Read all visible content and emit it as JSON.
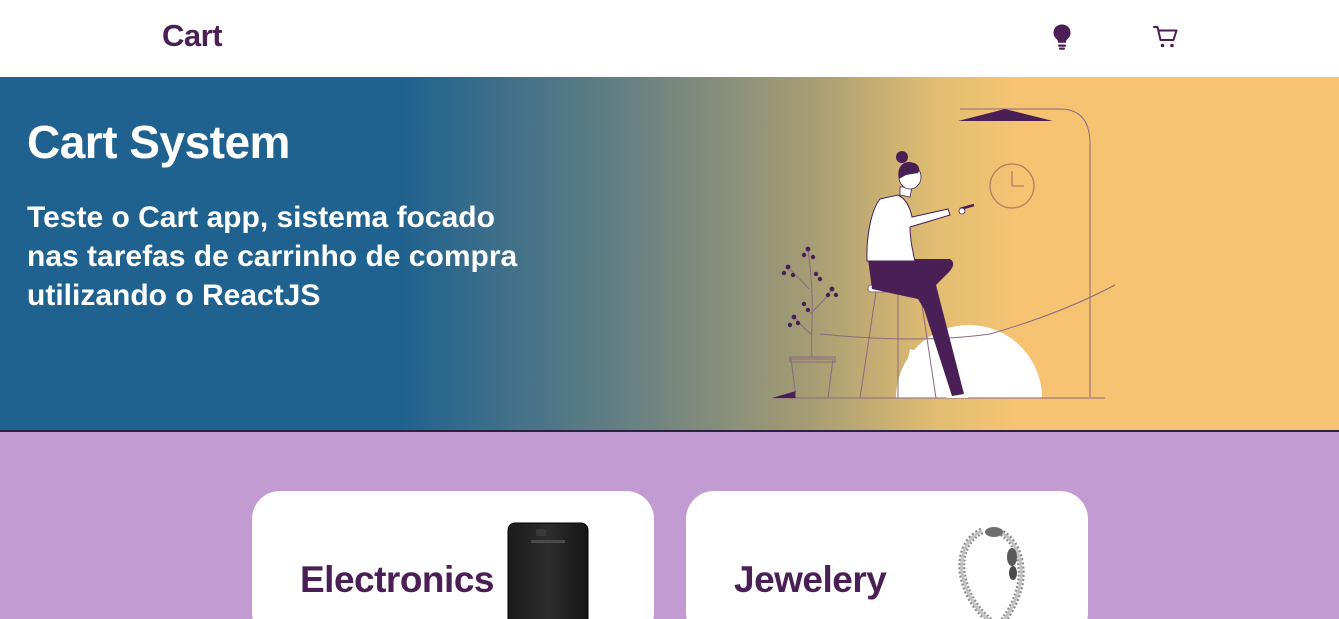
{
  "navbar": {
    "brand": "Cart",
    "icons": [
      "lightbulb-icon",
      "cart-icon"
    ]
  },
  "hero": {
    "title": "Cart System",
    "subtitle": "Teste o Cart app, sistema focado nas tarefas de carrinho de compra utilizando o ReactJS"
  },
  "categories": [
    {
      "label": "Electronics",
      "image": "external-hard-drive"
    },
    {
      "label": "Jewelery",
      "image": "silver-bracelet"
    }
  ],
  "colors": {
    "brand_purple": "#4a1f55",
    "background_lilac": "#c39bd3",
    "hero_blue": "#20628f",
    "hero_orange": "#f6c373",
    "white": "#ffffff"
  }
}
